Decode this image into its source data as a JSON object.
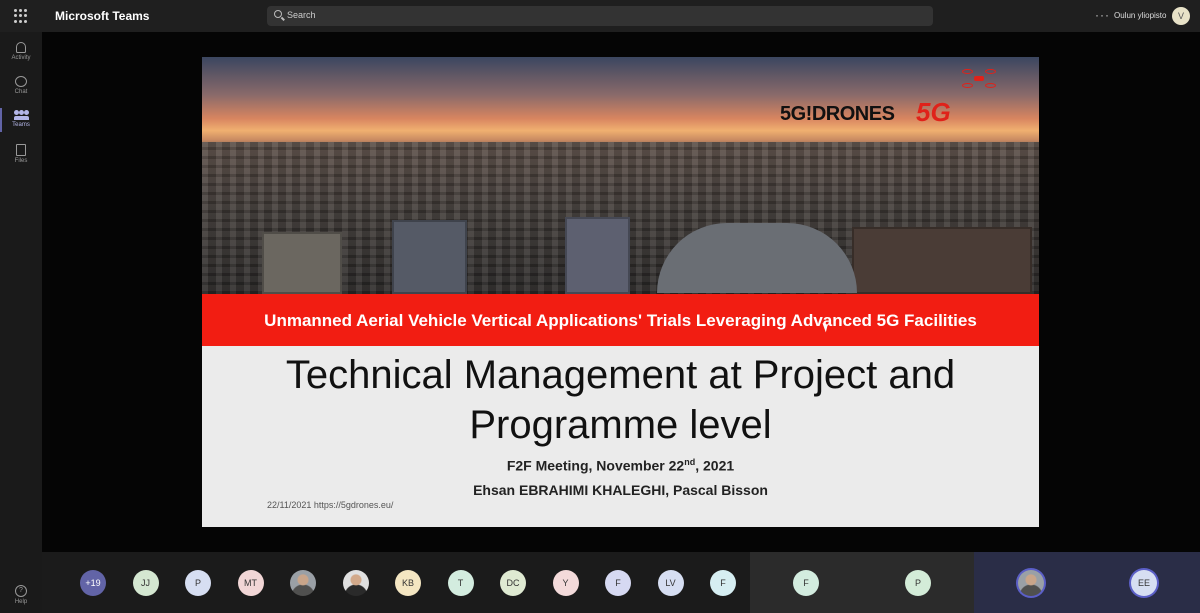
{
  "app": {
    "title": "Microsoft Teams",
    "org": "Oulun yliopisto",
    "user_initial": "V",
    "more": "···"
  },
  "search": {
    "placeholder": "Search"
  },
  "rail": [
    {
      "label": "Activity",
      "icon": "bell-icon"
    },
    {
      "label": "Chat",
      "icon": "chat-icon"
    },
    {
      "label": "Teams",
      "icon": "teams-icon",
      "active": true
    },
    {
      "label": "Files",
      "icon": "file-icon"
    }
  ],
  "rail_help": {
    "label": "Help",
    "icon": "help-icon"
  },
  "slide": {
    "logo_text": "5G!DRONES",
    "logo_5g": "5G",
    "banner": "Unmanned Aerial Vehicle Vertical Applications' Trials Leveraging Advanced 5G Facilities",
    "title_line1": "Technical Management at Project and",
    "title_line2": "Programme level",
    "meeting_prefix": "F2F Meeting, November 22",
    "meeting_sup": "nd",
    "meeting_suffix": ", 2021",
    "authors": "Ehsan EBRAHIMI KHALEGHI, Pascal Bisson",
    "footer": "22/11/2021   https://5gdrones.eu/"
  },
  "participants": [
    {
      "initials": "+19",
      "color": "#6264a7"
    },
    {
      "initials": "JJ",
      "color": "#d4e7d1"
    },
    {
      "initials": "P",
      "color": "#d6def2"
    },
    {
      "initials": "MT",
      "color": "#f1d6d6"
    },
    {
      "initials": "",
      "photo": true
    },
    {
      "initials": "",
      "photo": true
    },
    {
      "initials": "KB",
      "color": "#f4e6c2"
    },
    {
      "initials": "T",
      "color": "#d3ecdf"
    },
    {
      "initials": "DC",
      "color": "#dfead2"
    },
    {
      "initials": "Y",
      "color": "#f3dada"
    },
    {
      "initials": "F",
      "color": "#d6d9f2"
    },
    {
      "initials": "LV",
      "color": "#d6def2"
    },
    {
      "initials": "F",
      "color": "#d6eef2"
    }
  ],
  "spotlight_tiles": [
    {
      "initials": "F",
      "color": "#d3ecdf"
    },
    {
      "initials": "P",
      "color": "#d3ecd8"
    },
    {
      "initials": "",
      "photo": true
    },
    {
      "initials": "EE",
      "color": "#d6def2"
    }
  ]
}
